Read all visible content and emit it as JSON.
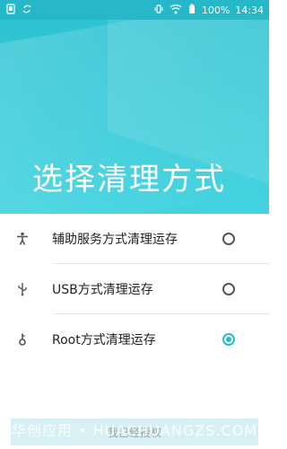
{
  "status_bar": {
    "battery": "100%",
    "time": "14:34"
  },
  "hero": {
    "title": "选择清理方式"
  },
  "options": [
    {
      "label": "辅助服务方式清理运存",
      "icon": "accessibility-icon",
      "checked": false
    },
    {
      "label": "USB方式清理运存",
      "icon": "usb-icon",
      "checked": false
    },
    {
      "label": "Root方式清理运存",
      "icon": "key-icon",
      "checked": true
    }
  ],
  "footer": {
    "button_label": "我已经授权",
    "watermark": "华创应用 • HUACHUANGZS.COM"
  },
  "colors": {
    "accent": "#20bcd0",
    "status_bar": "#26b7c8",
    "hero_top": "#2ec3d2",
    "hero_bottom": "#43d3e0"
  }
}
